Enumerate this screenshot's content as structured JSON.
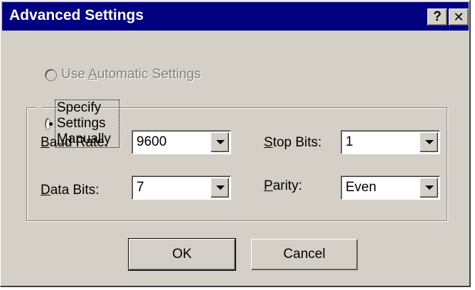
{
  "window": {
    "title": "Advanced Settings",
    "help_glyph": "?",
    "close_glyph": "✕"
  },
  "options": {
    "automatic": {
      "label_pre": "Use ",
      "label_key": "A",
      "label_post": "utomatic Settings",
      "selected": false,
      "enabled": false
    },
    "manual": {
      "label_pre": "Specify Settings ",
      "label_key": "M",
      "label_post": "anually",
      "selected": true,
      "enabled": true
    }
  },
  "fields": {
    "baud_rate": {
      "label_key": "B",
      "label_rest": "aud Rate:",
      "value": "9600"
    },
    "data_bits": {
      "label_key": "D",
      "label_rest": "ata Bits:",
      "value": "7"
    },
    "stop_bits": {
      "label_key": "S",
      "label_rest": "top Bits:",
      "value": "1"
    },
    "parity": {
      "label_key": "P",
      "label_rest": "arity:",
      "value": "Even"
    }
  },
  "buttons": {
    "ok": "OK",
    "cancel": "Cancel"
  },
  "colors": {
    "face": "#d4d0c8",
    "titlebar": "#000080",
    "disabled_text": "#808080"
  }
}
